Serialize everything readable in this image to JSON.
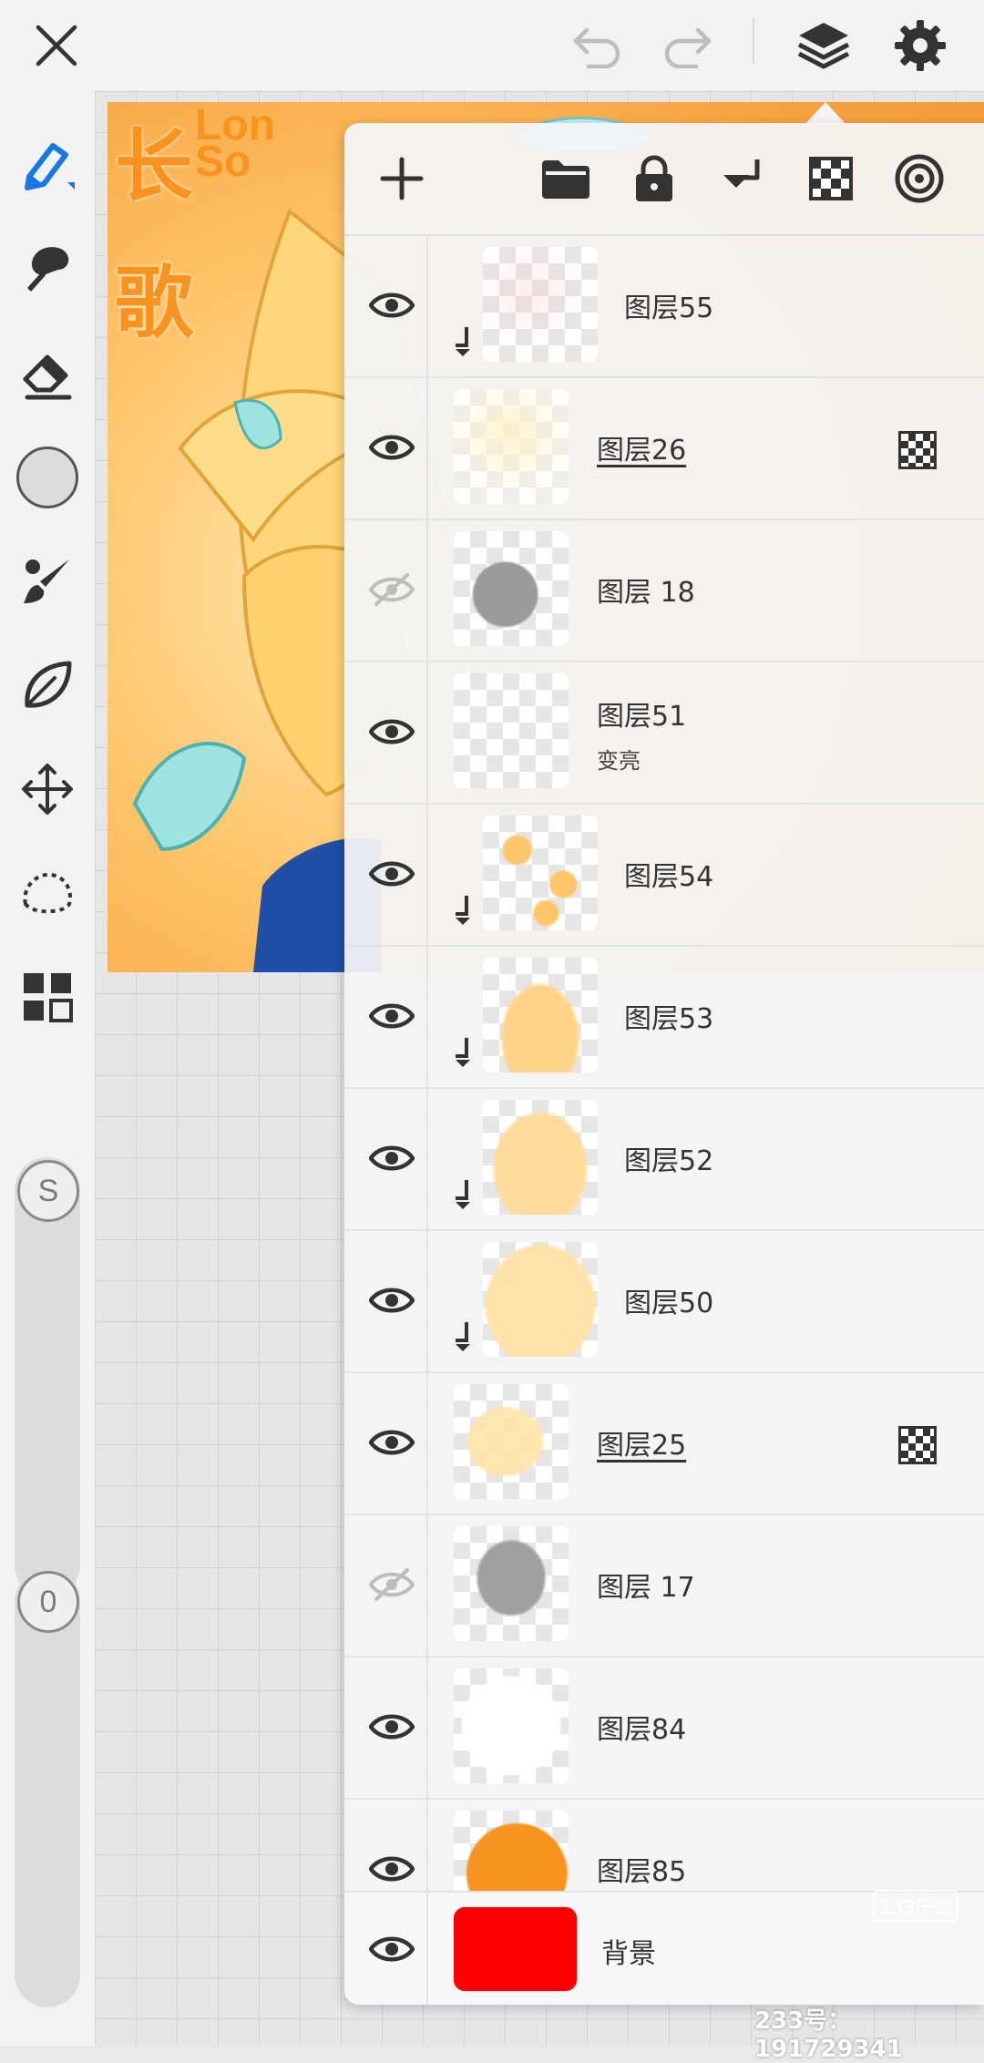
{
  "colors": {
    "accent": "#1677e6",
    "icon_dark": "#333333",
    "icon_disabled": "#bdbdbd",
    "background_fill": "#ff0000"
  },
  "topbar": {
    "close_icon": "close-icon",
    "undo_icon": "undo-icon",
    "redo_icon": "redo-icon",
    "layers_icon": "layers-icon",
    "settings_icon": "gear-icon"
  },
  "tools": [
    {
      "name": "pen-tool-icon",
      "selected": true
    },
    {
      "name": "smudge-tool-icon",
      "selected": false
    },
    {
      "name": "eraser-tool-icon",
      "selected": false
    },
    {
      "name": "color-swatch",
      "selected": false
    },
    {
      "name": "brush-settings-icon",
      "selected": false
    },
    {
      "name": "leaf-tool-icon",
      "selected": false
    },
    {
      "name": "move-tool-icon",
      "selected": false
    },
    {
      "name": "lasso-tool-icon",
      "selected": false
    },
    {
      "name": "grid-menu-icon",
      "selected": false
    }
  ],
  "sliders": {
    "size_label": "S",
    "opacity_label": "0"
  },
  "artwork": {
    "title_cn_1": "长",
    "title_cn_2": "歌",
    "title_en_1": "Lon",
    "title_en_2": "So"
  },
  "layers_toolbar": {
    "add_icon": "plus-icon",
    "folder_icon": "folder-icon",
    "lock_icon": "lock-icon",
    "merge_down_icon": "merge-down-icon",
    "transparency_icon": "checker-icon",
    "reference_icon": "target-icon"
  },
  "layers": [
    {
      "name": "图层55",
      "visible": true,
      "clipped": true,
      "underlined": false,
      "alpha_lock": false,
      "blend": ""
    },
    {
      "name": "图层26",
      "visible": true,
      "clipped": false,
      "underlined": true,
      "alpha_lock": true,
      "blend": ""
    },
    {
      "name": "图层 18",
      "visible": false,
      "clipped": false,
      "underlined": false,
      "alpha_lock": false,
      "blend": ""
    },
    {
      "name": "图层51",
      "visible": true,
      "clipped": false,
      "underlined": false,
      "alpha_lock": false,
      "blend": "变亮"
    },
    {
      "name": "图层54",
      "visible": true,
      "clipped": true,
      "underlined": false,
      "alpha_lock": false,
      "blend": ""
    },
    {
      "name": "图层53",
      "visible": true,
      "clipped": true,
      "underlined": false,
      "alpha_lock": false,
      "blend": ""
    },
    {
      "name": "图层52",
      "visible": true,
      "clipped": true,
      "underlined": false,
      "alpha_lock": false,
      "blend": ""
    },
    {
      "name": "图层50",
      "visible": true,
      "clipped": true,
      "underlined": false,
      "alpha_lock": false,
      "blend": ""
    },
    {
      "name": "图层25",
      "visible": true,
      "clipped": false,
      "underlined": true,
      "alpha_lock": true,
      "blend": ""
    },
    {
      "name": "图层 17",
      "visible": false,
      "clipped": false,
      "underlined": false,
      "alpha_lock": false,
      "blend": ""
    },
    {
      "name": "图层84",
      "visible": true,
      "clipped": false,
      "underlined": false,
      "alpha_lock": false,
      "blend": ""
    },
    {
      "name": "图层85",
      "visible": true,
      "clipped": false,
      "underlined": false,
      "alpha_lock": false,
      "blend": ""
    }
  ],
  "background_layer": {
    "name": "背景",
    "visible": true
  },
  "watermark": {
    "badge": "233乐园",
    "id_text": "233号：191729341"
  }
}
